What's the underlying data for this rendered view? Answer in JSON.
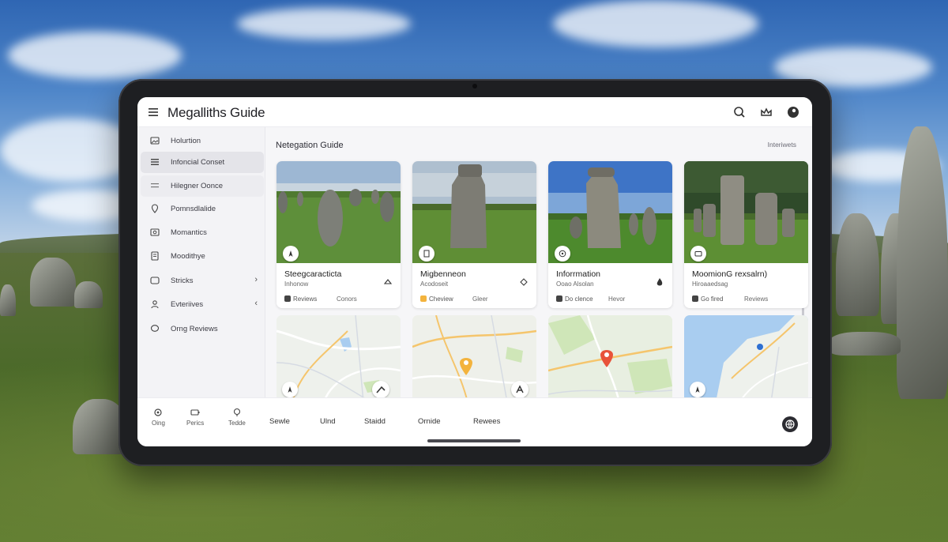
{
  "app": {
    "title": "Megalliths Guide"
  },
  "topbar": {
    "icons": [
      "search-icon",
      "crown-icon",
      "profile-icon"
    ]
  },
  "sidebar": {
    "items": [
      {
        "label": "Holurtion",
        "icon": "image-icon"
      },
      {
        "label": "Infoncial Conset",
        "icon": "list-icon"
      },
      {
        "label": "Hilegner Oonce",
        "icon": "list-icon"
      },
      {
        "label": "Pomnsdlalide",
        "icon": "location-icon"
      },
      {
        "label": "Momantics",
        "icon": "photo-icon"
      },
      {
        "label": "Moodithye",
        "icon": "document-icon"
      },
      {
        "label": "Stricks",
        "icon": "tag-icon",
        "chevron": "›"
      },
      {
        "label": "Evteriives",
        "icon": "person-icon",
        "chevron": "‹"
      },
      {
        "label": "Orng Reviews",
        "icon": "chat-icon"
      }
    ]
  },
  "main": {
    "section_title": "Netegation Guide",
    "section_link": "Interiwets"
  },
  "cards": [
    {
      "name": "Steegcaracticta",
      "subtitle": "Inhonow",
      "meta1": "Reviews",
      "meta2": "Conors"
    },
    {
      "name": "Migbenneon",
      "subtitle": "Acodoseit",
      "meta1": "Cheview",
      "meta2": "Gleer"
    },
    {
      "name": "Inforrmation",
      "subtitle": "Ooao Alsolan",
      "meta1": "Do clence",
      "meta2": "Hevor"
    },
    {
      "name": "MoomionG rexsalrn)",
      "subtitle": "Hiroaaedsag",
      "meta1": "Go fired",
      "meta2": "Reviews"
    }
  ],
  "bottombar": {
    "items": [
      {
        "label": "Oing",
        "icon": "settings-icon"
      },
      {
        "label": "Perics",
        "icon": "battery-icon"
      },
      {
        "label": "Tedde",
        "icon": "pin-icon"
      }
    ],
    "tabs": [
      "Sewle",
      "Ulnd",
      "Staidd",
      "Ornide",
      "Rewees"
    ]
  },
  "colors": {
    "accent_pin_yellow": "#f3b33d",
    "accent_pin_red": "#e8523a",
    "map_water": "#a9cdf0",
    "map_park": "#cfe6b8"
  }
}
